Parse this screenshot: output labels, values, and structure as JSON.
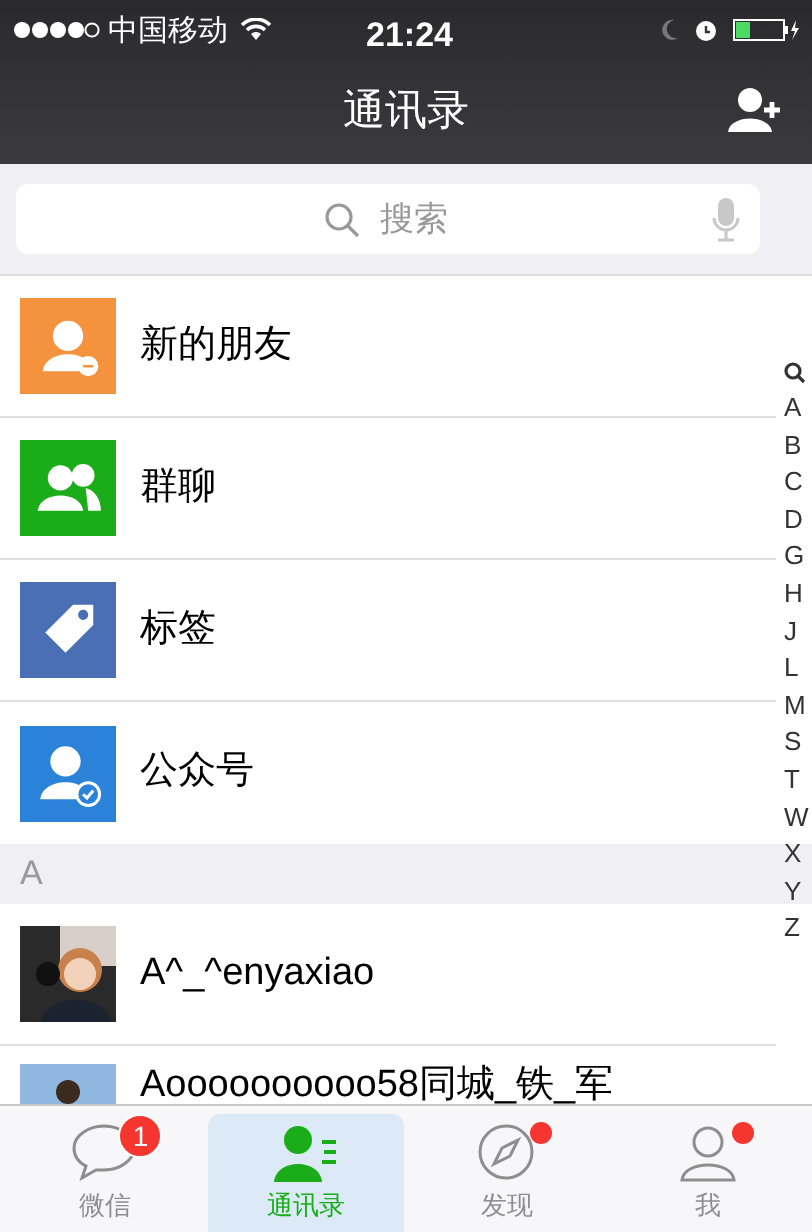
{
  "status_bar": {
    "carrier": "中国移动",
    "time": "21:24"
  },
  "nav": {
    "title": "通讯录"
  },
  "search": {
    "placeholder": "搜索"
  },
  "functions": [
    {
      "kind": "new_friends",
      "label": "新的朋友",
      "color": "#f5923e"
    },
    {
      "kind": "groups",
      "label": "群聊",
      "color": "#1aad19"
    },
    {
      "kind": "tags",
      "label": "标签",
      "color": "#4a6fb5"
    },
    {
      "kind": "official",
      "label": "公众号",
      "color": "#2b82d9"
    }
  ],
  "sections": [
    {
      "header": "A",
      "contacts": [
        {
          "name": "A^_^enyaxiao"
        },
        {
          "name": "Aoooooooooo58同城_铁_军"
        }
      ]
    }
  ],
  "index": [
    "A",
    "B",
    "C",
    "D",
    "G",
    "H",
    "J",
    "L",
    "M",
    "S",
    "T",
    "W",
    "X",
    "Y",
    "Z"
  ],
  "tabs": [
    {
      "kind": "chats",
      "label": "微信",
      "selected": false,
      "badge": "1",
      "dot": false
    },
    {
      "kind": "contacts",
      "label": "通讯录",
      "selected": true,
      "dot": false
    },
    {
      "kind": "discover",
      "label": "发现",
      "selected": false,
      "dot": true
    },
    {
      "kind": "me",
      "label": "我",
      "selected": false,
      "dot": true
    }
  ]
}
